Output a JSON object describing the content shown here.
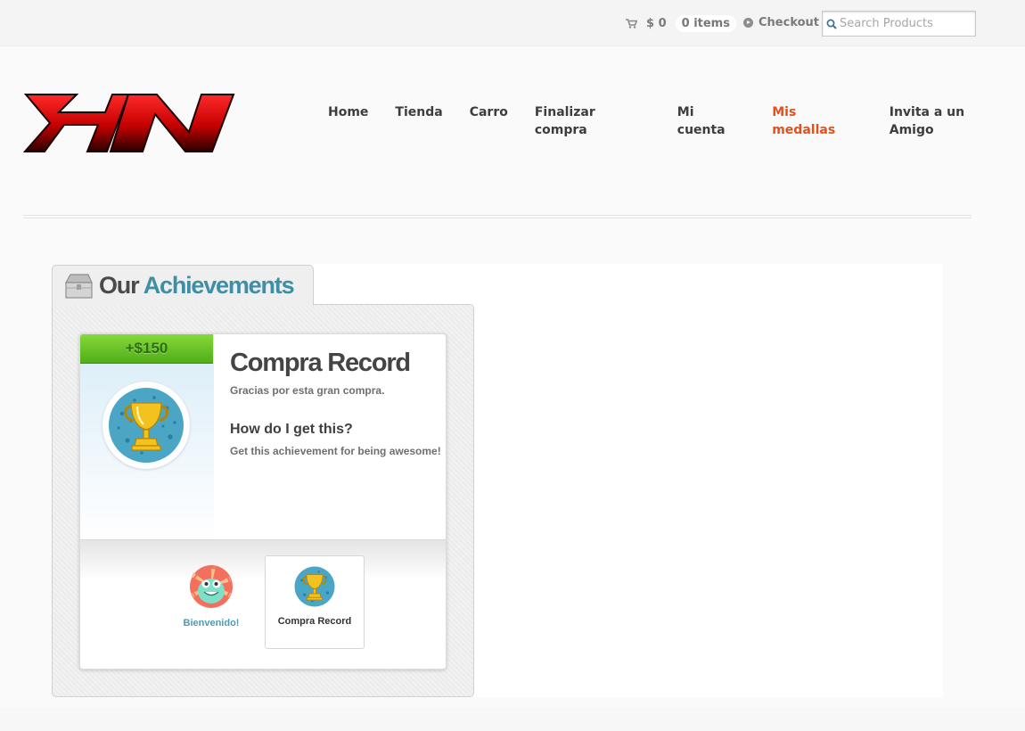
{
  "topbar": {
    "cart_total": "$ 0",
    "cart_items": "0 items",
    "checkout_label": "Checkout",
    "search_placeholder": "Search Products"
  },
  "nav": {
    "items": [
      "Home",
      "Tienda",
      "Carro",
      "Finalizar compra",
      "Mi cuenta",
      "Mis medallas",
      "Invita a un Amigo"
    ],
    "active": "Mis medallas"
  },
  "achievements": {
    "heading_part1": "Our",
    "heading_part2": "Achievements",
    "current": {
      "points": "+$150",
      "title": "Compra Record",
      "description": "Gracias por esta gran compra.",
      "how_heading": "How do I get this?",
      "how_description": "Get this achievement for being awesome!"
    },
    "list": [
      {
        "label": "Bienvenido!"
      },
      {
        "label": "Compra Record"
      }
    ]
  },
  "colors": {
    "accent": "#3f8ea7",
    "active_nav": "#e3501a",
    "points_bar": "#6cc52a",
    "logo_red": "#e00000"
  }
}
